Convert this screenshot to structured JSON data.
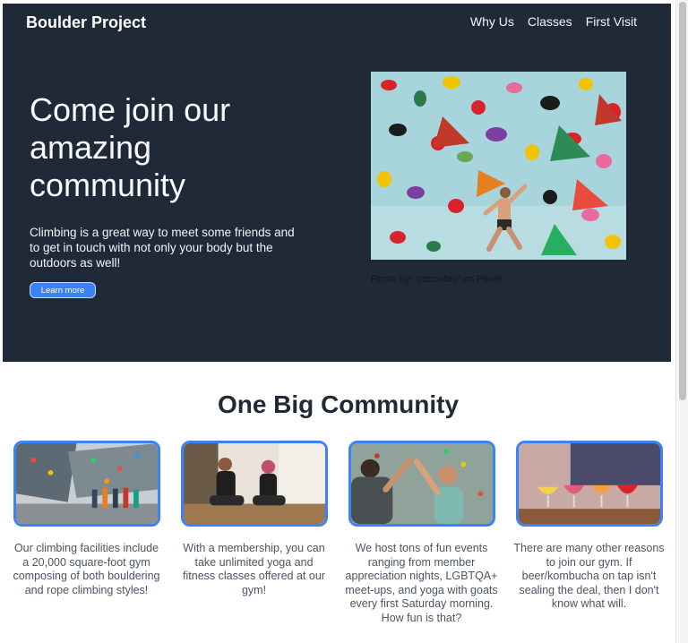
{
  "header": {
    "brand": "Boulder Project",
    "nav": [
      "Why Us",
      "Classes",
      "First Visit"
    ]
  },
  "hero": {
    "title": "Come join our amazing community",
    "subtitle": "Climbing is a great way to meet some friends and to get in touch with not only your body but the outdoors as well!",
    "button_label": "Learn more",
    "photo_credit": "Photo by: 'cottonbro' on Pexel"
  },
  "community": {
    "title": "One Big Community",
    "cards": [
      {
        "text": "Our climbing facilities include a 20,000 square-foot gym composing of both bouldering and rope climbing styles!"
      },
      {
        "text": "With a membership, you can take unlimited yoga and fitness classes offered at our gym!"
      },
      {
        "text": "We host tons of fun events ranging from member appreciation nights, LGBTQA+ meet-ups, and yoga with goats every first Saturday morning. How fun is that?"
      },
      {
        "text": "There are many other reasons to join our gym. If beer/kombucha on tap isn't sealing the deal, then I don't know what will."
      }
    ]
  },
  "colors": {
    "hero_bg": "#1f2937",
    "accent": "#3b82f6",
    "body_text": "#4b5563"
  }
}
